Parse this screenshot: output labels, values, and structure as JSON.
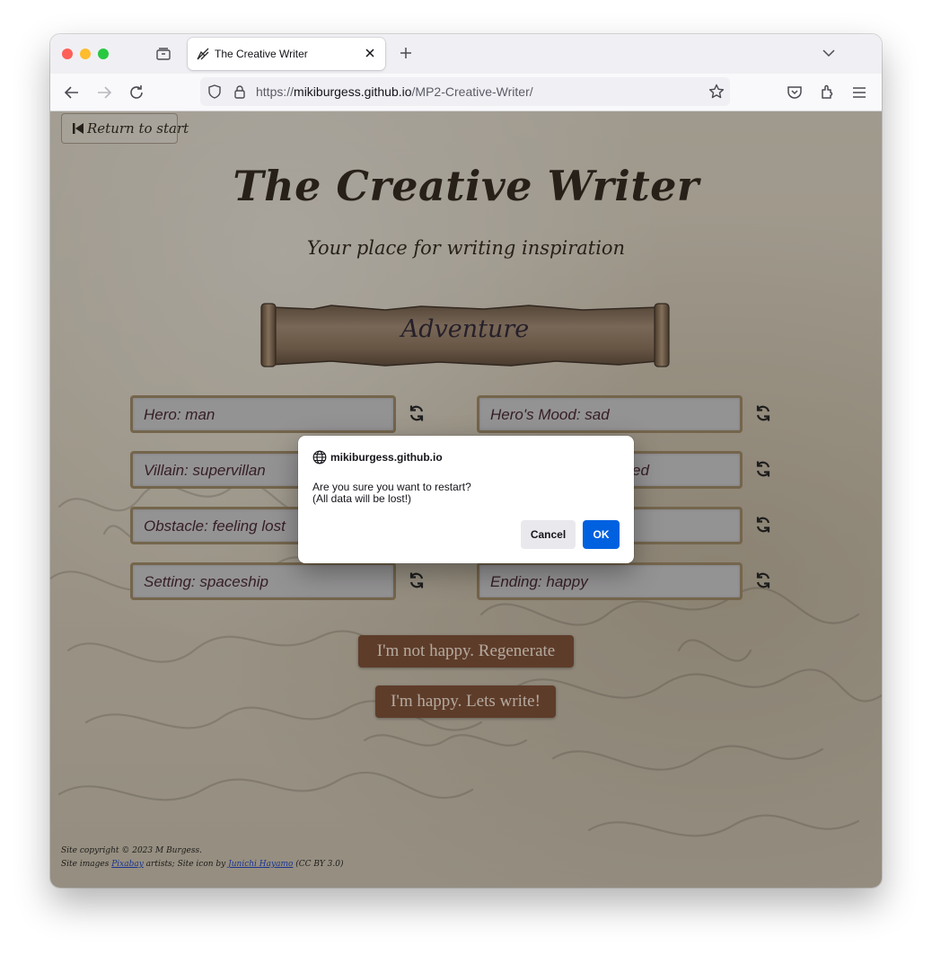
{
  "browser": {
    "tab": {
      "title": "The Creative Writer",
      "favicon": "quill-favicon-icon"
    },
    "url": {
      "scheme": "https://",
      "domain": "mikiburgess.github.io",
      "path": "/MP2-Creative-Writer/"
    },
    "icons": [
      "tab-overview-icon",
      "close-tab-icon",
      "new-tab-icon",
      "tab-list-chevron-icon",
      "back-arrow-icon",
      "forward-arrow-icon",
      "reload-icon",
      "shield-icon",
      "lock-icon",
      "bookmark-star-icon",
      "pocket-icon",
      "extensions-icon",
      "menu-icon"
    ]
  },
  "page": {
    "return_label": "Return to start",
    "title": "The Creative Writer",
    "subtitle": "Your place for writing inspiration",
    "genre": "Adventure",
    "fields": [
      {
        "text": "Hero: man"
      },
      {
        "text": "Hero's Mood: sad"
      },
      {
        "text": "Villain: supervillan"
      },
      {
        "text": "ed"
      },
      {
        "text": "Obstacle: feeling lost"
      },
      {
        "text": ""
      },
      {
        "text": "Setting: spaceship"
      },
      {
        "text": "Ending: happy"
      }
    ],
    "regenerate_label": "I'm not happy. Regenerate",
    "write_label": "I'm happy. Lets write!",
    "footer": {
      "line1": "Site copyright © 2023 M Burgess.",
      "line2_pre": "Site images ",
      "link1": "Pixabay",
      "line2_mid": " artists; Site icon by ",
      "link2": "Junichi Hayamo",
      "line2_post": " (CC BY 3.0)"
    }
  },
  "dialog": {
    "host": "mikiburgess.github.io",
    "message_line1": "Are you sure you want to restart?",
    "message_line2": "(All data will be lost!)",
    "cancel_label": "Cancel",
    "ok_label": "OK"
  },
  "colors": {
    "accent_blue": "#0061e0",
    "button_brown": "#7a4a30",
    "field_border": "#9a8460",
    "field_text": "#3f1f28"
  }
}
